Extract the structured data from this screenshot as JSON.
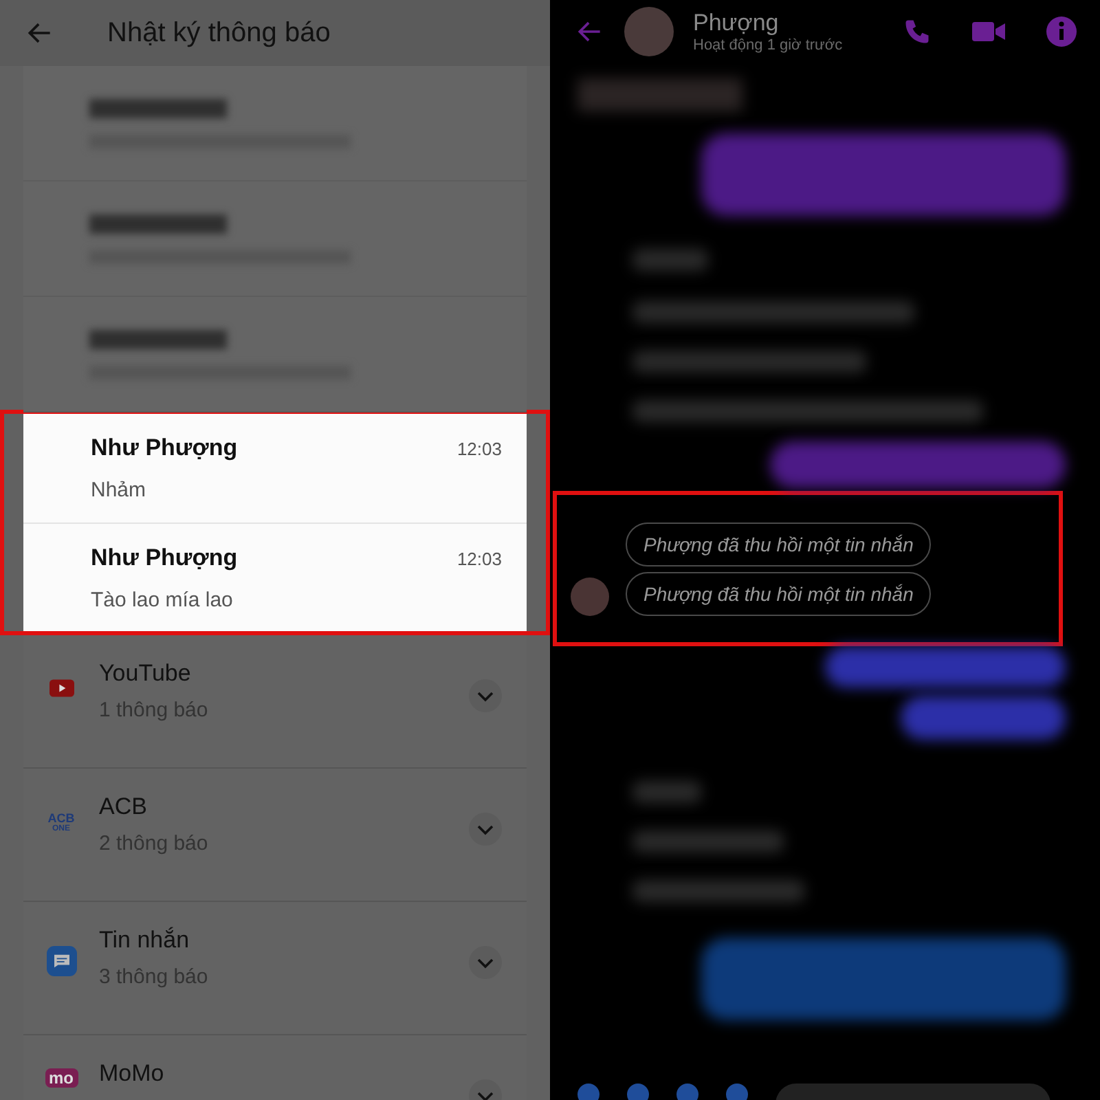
{
  "notification_log": {
    "title": "Nhật ký thông báo",
    "highlighted_messages": [
      {
        "sender": "Như Phượng",
        "time": "12:03",
        "text": "Nhảm"
      },
      {
        "sender": "Như Phượng",
        "time": "12:03",
        "text": "Tào lao mía lao"
      }
    ],
    "apps": [
      {
        "name": "YouTube",
        "count": "1 thông báo",
        "kind": "youtube"
      },
      {
        "name": "ACB",
        "count": "2 thông báo",
        "kind": "acb",
        "logo_lines": [
          "ACB",
          "ONE"
        ]
      },
      {
        "name": "Tin nhắn",
        "count": "3 thông báo",
        "kind": "messages"
      },
      {
        "name": "MoMo",
        "kind": "momo",
        "logo_lines": [
          "mo"
        ]
      }
    ]
  },
  "chat": {
    "contact": "Phượng",
    "status": "Hoạt động 1 giờ trước",
    "recalled_messages": [
      "Phượng đã thu hồi một tin nhắn",
      "Phượng đã thu hồi một tin nhắn"
    ]
  }
}
